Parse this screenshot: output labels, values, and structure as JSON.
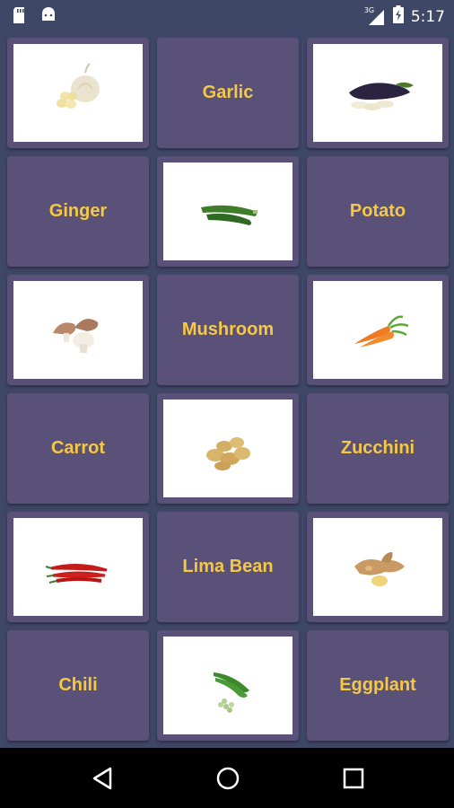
{
  "status_bar": {
    "time": "5:17",
    "network": "3G",
    "icons": [
      "sd-card-icon",
      "android-icon",
      "signal-icon",
      "battery-charging-icon"
    ]
  },
  "cards": [
    {
      "type": "image",
      "icon": "garlic"
    },
    {
      "type": "text",
      "label": "Garlic"
    },
    {
      "type": "image",
      "icon": "eggplant"
    },
    {
      "type": "text",
      "label": "Ginger"
    },
    {
      "type": "image",
      "icon": "zucchini"
    },
    {
      "type": "text",
      "label": "Potato"
    },
    {
      "type": "image",
      "icon": "mushroom"
    },
    {
      "type": "text",
      "label": "Mushroom"
    },
    {
      "type": "image",
      "icon": "carrot"
    },
    {
      "type": "text",
      "label": "Carrot"
    },
    {
      "type": "image",
      "icon": "potato"
    },
    {
      "type": "text",
      "label": "Zucchini"
    },
    {
      "type": "image",
      "icon": "chili"
    },
    {
      "type": "text",
      "label": "Lima Bean"
    },
    {
      "type": "image",
      "icon": "ginger"
    },
    {
      "type": "text",
      "label": "Chili"
    },
    {
      "type": "image",
      "icon": "lima-bean"
    },
    {
      "type": "text",
      "label": "Eggplant"
    }
  ],
  "nav_bar": {
    "buttons": [
      "back-icon",
      "home-icon",
      "recents-icon"
    ]
  },
  "colors": {
    "background": "#3f4766",
    "card": "#595177",
    "label": "#f6c843",
    "nav": "#000000"
  }
}
